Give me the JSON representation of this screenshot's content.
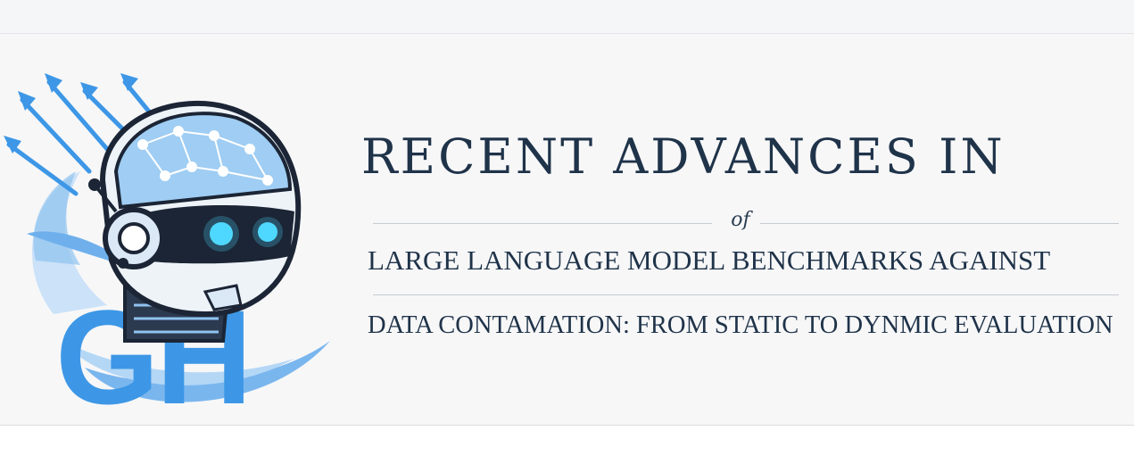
{
  "banner": {
    "logo_letters": "GH",
    "title": "RECENT ADVANCES IN",
    "connector": "of",
    "line2": "LARGE LANGUAGE MODEL BENCHMARKS AGAINST",
    "line3": "DATA CONTAMATION: FROM STATIC TO DYNMIC EVALUATION"
  },
  "colors": {
    "title_navy": "#1f3349",
    "logo_blue": "#3d97e6",
    "logo_dark": "#1b2535",
    "eye_glow": "#4fd8ff"
  },
  "icons": {
    "logo": "robot-head-logo-icon"
  }
}
